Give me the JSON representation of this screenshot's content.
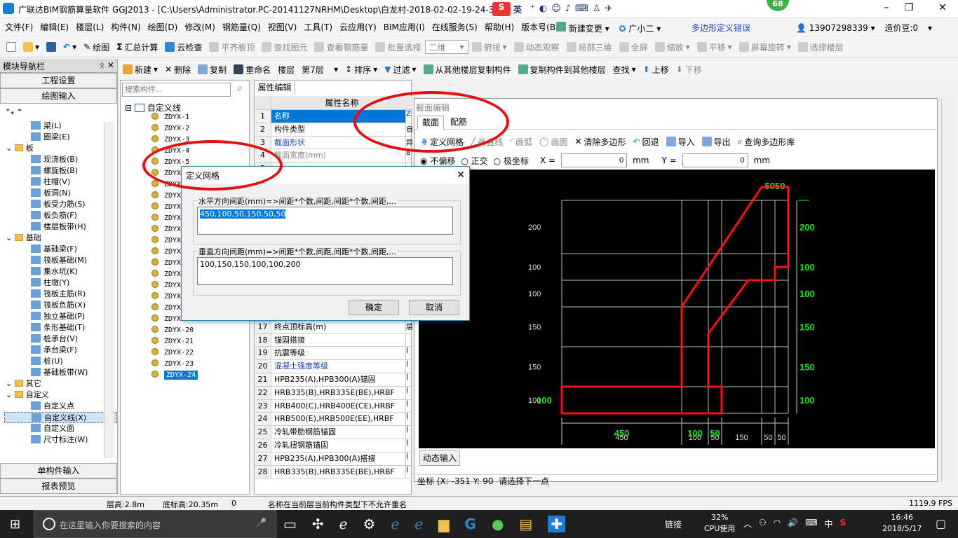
{
  "window": {
    "title": "广联达BIM钢筋算量软件 GGJ2013 - [C:\\Users\\Administrator.PC-20141127NRHM\\Desktop\\白龙村-2018-02-02-19-24-35",
    "badge": "68",
    "ime_label": "英"
  },
  "menubar": {
    "items": [
      "文件(F)",
      "编辑(E)",
      "楼层(L)",
      "构件(N)",
      "绘图(D)",
      "修改(M)",
      "钢筋量(Q)",
      "视图(V)",
      "工具(T)",
      "云应用(Y)",
      "BIM应用(I)",
      "在线服务(S)",
      "帮助(H)",
      "版本号(B)"
    ],
    "new_change": "新建变更",
    "xiaoer": "广小二",
    "error_msg": "多边形定义错误",
    "phone": "13907298339",
    "bean": "造价豆:0"
  },
  "toolbar1": {
    "items": [
      "绘图",
      "汇总计算",
      "云检查",
      "平齐板顶",
      "查找图元",
      "查看钢筋量",
      "批量选择"
    ],
    "view_select": "二维",
    "view_items": [
      "俯视",
      "动态观察",
      "局部三维",
      "全屏",
      "缩放",
      "平移",
      "屏幕旋转",
      "选择楼层"
    ]
  },
  "toolbar2": {
    "items": [
      "新建",
      "删除",
      "复制",
      "重命名",
      "楼层",
      "第7层",
      "排序",
      "过滤",
      "从其他楼层复制构件",
      "复制构件到其他楼层",
      "查找",
      "上移",
      "下移"
    ]
  },
  "nav": {
    "header": "模块导航栏",
    "btn_project": "工程设置",
    "btn_draw": "绘图输入",
    "tree": [
      {
        "label": "梁(L)",
        "level": 2
      },
      {
        "label": "圈梁(E)",
        "level": 2
      },
      {
        "label": "板",
        "level": 1
      },
      {
        "label": "现浇板(B)",
        "level": 2
      },
      {
        "label": "螺旋板(B)",
        "level": 2
      },
      {
        "label": "柱帽(V)",
        "level": 2
      },
      {
        "label": "板洞(N)",
        "level": 2
      },
      {
        "label": "板受力筋(S)",
        "level": 2
      },
      {
        "label": "板负筋(F)",
        "level": 2
      },
      {
        "label": "楼层板带(H)",
        "level": 2
      },
      {
        "label": "基础",
        "level": 1
      },
      {
        "label": "基础梁(F)",
        "level": 2
      },
      {
        "label": "筏板基础(M)",
        "level": 2
      },
      {
        "label": "集水坑(K)",
        "level": 2
      },
      {
        "label": "柱墩(Y)",
        "level": 2
      },
      {
        "label": "筏板主筋(R)",
        "level": 2
      },
      {
        "label": "筏板负筋(X)",
        "level": 2
      },
      {
        "label": "独立基础(P)",
        "level": 2
      },
      {
        "label": "条形基础(T)",
        "level": 2
      },
      {
        "label": "桩承台(V)",
        "level": 2
      },
      {
        "label": "承台梁(F)",
        "level": 2
      },
      {
        "label": "桩(U)",
        "level": 2
      },
      {
        "label": "基础板带(W)",
        "level": 2
      },
      {
        "label": "其它",
        "level": 1
      },
      {
        "label": "自定义",
        "level": 1
      },
      {
        "label": "自定义点",
        "level": 2
      },
      {
        "label": "自定义线(X)",
        "level": 2
      },
      {
        "label": "自定义面",
        "level": 2
      },
      {
        "label": "尺寸标注(W)",
        "level": 2
      }
    ],
    "btn_single": "单构件输入",
    "btn_report": "报表预览"
  },
  "components": {
    "search_placeholder": "搜索构件...",
    "root": "自定义线",
    "items": [
      "ZDYX-1",
      "ZDYX-2",
      "ZDYX-3",
      "ZDYX-4",
      "ZDYX-5",
      "ZDYX-6",
      "ZDYX-7",
      "ZDYX-8",
      "ZDYX-9",
      "ZDYX-10",
      "ZDYX-11",
      "ZDYX-12",
      "ZDYX-13",
      "ZDYX-14",
      "ZDYX-15",
      "ZDYX-16",
      "ZDYX-17",
      "ZDYX-18",
      "ZDYX-19",
      "ZDYX-20",
      "ZDYX-21",
      "ZDYX-22",
      "ZDYX-23",
      "ZDYX-24"
    ],
    "selected": "ZDYX-24"
  },
  "props": {
    "tab": "属性编辑",
    "col_name": "属性名称",
    "rows": [
      {
        "n": "1",
        "name": "名称",
        "val": "Z"
      },
      {
        "n": "2",
        "name": "构件类型",
        "val": "自"
      },
      {
        "n": "3",
        "name": "截面形状",
        "val": "异"
      },
      {
        "n": "4",
        "name": "截面宽度(mm)",
        "val": "8"
      },
      {
        "n": "5",
        "name": "",
        "val": ""
      },
      {
        "n": "6",
        "name": "",
        "val": ""
      },
      {
        "n": "7",
        "name": "",
        "val": ""
      },
      {
        "n": "8",
        "name": "",
        "val": ""
      },
      {
        "n": "9",
        "name": "",
        "val": ""
      },
      {
        "n": "10",
        "name": "",
        "val": ""
      },
      {
        "n": "11",
        "name": "",
        "val": ""
      },
      {
        "n": "12",
        "name": "",
        "val": ""
      },
      {
        "n": "13",
        "name": "",
        "val": ""
      },
      {
        "n": "14",
        "name": "",
        "val": ""
      },
      {
        "n": "15",
        "name": "",
        "val": ""
      },
      {
        "n": "16",
        "name": "",
        "val": ""
      },
      {
        "n": "17",
        "name": "终点顶标高(m)",
        "val": "层"
      },
      {
        "n": "18",
        "name": "锚固搭接",
        "val": ""
      },
      {
        "n": "19",
        "name": "抗震等级",
        "val": "("
      },
      {
        "n": "20",
        "name": "混凝土强度等级",
        "val": "("
      },
      {
        "n": "21",
        "name": "HPB235(A),HPB300(A)锚固",
        "val": "("
      },
      {
        "n": "22",
        "name": "HRB335(B),HRB335E(BE),HRBF",
        "val": "("
      },
      {
        "n": "23",
        "name": "HRB400(C),HRB400E(CE),HRBF",
        "val": "("
      },
      {
        "n": "24",
        "name": "HRB500(E),HRB500E(EE),HRBF",
        "val": "("
      },
      {
        "n": "25",
        "name": "冷轧带肋钢筋锚固",
        "val": "("
      },
      {
        "n": "26",
        "name": "冷轧扭钢筋锚固",
        "val": "("
      },
      {
        "n": "27",
        "name": "HPB235(A),HPB300(A)搭接",
        "val": "("
      },
      {
        "n": "28",
        "name": "HRB335(B),HRB335E(BE),HRBF",
        "val": "("
      }
    ]
  },
  "section_editor": {
    "title": "截面编辑",
    "tabs": [
      "截面",
      "配筋"
    ],
    "tools": [
      "定义网格",
      "画直线",
      "画弧",
      "画圆",
      "清除多边形",
      "回退",
      "导入",
      "导出",
      "查询多边形库"
    ],
    "radio": [
      "不偏移",
      "正交",
      "极坐标"
    ],
    "x_label": "X =",
    "x_value": "0",
    "y_label": "Y =",
    "y_value": "0",
    "unit": "mm",
    "dynamic_input": "动态输入",
    "coord": "坐标 (X: -351 Y: 90",
    "prompt": "请选择下一点"
  },
  "grid": {
    "h_spacings": [
      450,
      100,
      50,
      150,
      50,
      50
    ],
    "v_spacings": [
      100,
      150,
      150,
      100,
      100,
      200
    ],
    "left_labels": [
      "200",
      "100",
      "100",
      "150",
      "150",
      "100"
    ],
    "right_labels": [
      "200",
      "100",
      "100",
      "150",
      "150",
      "100"
    ],
    "bottom_white": [
      "450",
      "100",
      "50",
      "150",
      "50",
      "50"
    ],
    "bottom_green": [
      "450",
      "100",
      "50"
    ],
    "top_green": "5050"
  },
  "dialog": {
    "title": "定义网格",
    "h_label": "水平方向间距(mm)=>间距*个数,间距,间距*个数,间距,...",
    "h_value": "450,100,50,150,50,50",
    "v_label": "垂直方向间距(mm)=>间距*个数,间距,间距*个数,间距,...",
    "v_value": "100,150,150,100,100,200",
    "ok": "确定",
    "cancel": "取消"
  },
  "status": {
    "floor_h": "层高:2.8m",
    "base_h": "底标高:20.35m",
    "count": "0",
    "msg": "名称在当前层当前构件类型下不允许重名",
    "fps": "1119.9 FPS"
  },
  "taskbar": {
    "search": "在这里输入你要搜索的内容",
    "link": "链接",
    "cpu_pct": "32%",
    "cpu_label": "CPU使用",
    "lang": "中",
    "time": "16:46",
    "date": "2018/5/17"
  },
  "colors": {
    "accent": "#3c7fb1",
    "grid_red": "#ff1010",
    "grid_green": "#22dd22",
    "selection": "#0078d7"
  }
}
